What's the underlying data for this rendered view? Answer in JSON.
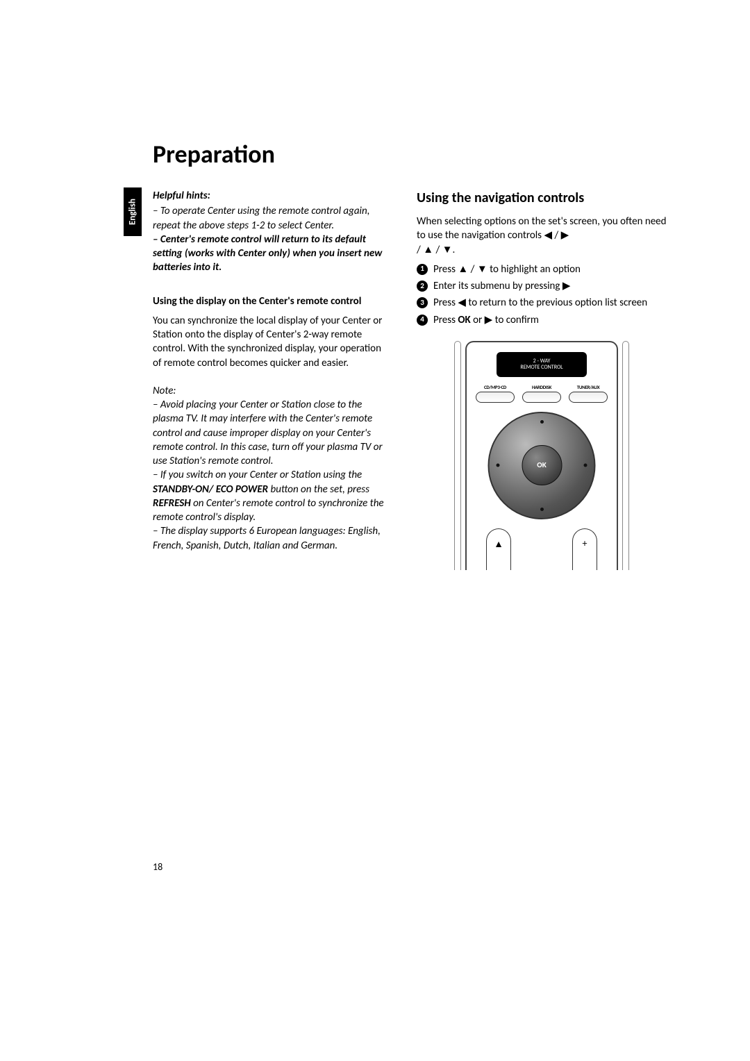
{
  "language_tab": "English",
  "title": "Preparation",
  "left": {
    "hints_head": "Helpful hints:",
    "hint1": "–  To operate Center using the remote control again, repeat the above steps 1-2 to select Center.",
    "hint2": "–  Center's remote control will return to its default setting (works with Center only) when you insert new batteries into it.",
    "subhead": "Using the display on the Center's remote control",
    "body": "You can synchronize the local display of your Center or Station onto the display of Center's 2-way remote control. With the synchronized display, your operation of remote control becomes quicker and easier.",
    "note_head": "Note:",
    "note1": "–  Avoid placing your Center or Station close to the plasma TV.  It may interfere with the Center's remote control and cause improper display on your Center's remote control. In this case, turn off your plasma TV or use Station's remote control.",
    "note2a": "–  If you switch on your Center or Station using the ",
    "note2b": "STANDBY-ON/ ECO POWER",
    "note2c": " button on the set,  press ",
    "note2d": "REFRESH",
    "note2e": " on Center's remote control to synchronize the remote control's display.",
    "note3": "–  The display supports 6 European languages: English, French, Spanish, Dutch, Italian and German."
  },
  "right": {
    "heading": "Using the navigation controls",
    "intro_a": "When selecting options on the set's screen, you often need to use the navigation controls ",
    "intro_b": " / ",
    "intro_c": " / ",
    "intro_d": " / ",
    "intro_e": ".",
    "step1_a": "Press  ",
    "step1_b": "  /  ",
    "step1_c": " to highlight an option",
    "step2_a": "Enter its submenu by pressing  ",
    "step3_a": "Press ",
    "step3_b": " to return to the previous option list screen",
    "step4_a": "Press ",
    "step4_ok": "OK",
    "step4_b": " or  ",
    "step4_c": "  to confirm"
  },
  "glyphs": {
    "left": "◀",
    "right": "▶",
    "up": "▲",
    "down": "▼",
    "plus": "+",
    "tri_up": "▲"
  },
  "remote": {
    "screen_l1": "2 - WAY",
    "screen_l2": "REMOTE CONTROL",
    "btn1": "CD/MP3-CD",
    "btn2": "HARDDISK",
    "btn3": "TUNER/AUX",
    "ok": "OK"
  },
  "page_number": "18"
}
